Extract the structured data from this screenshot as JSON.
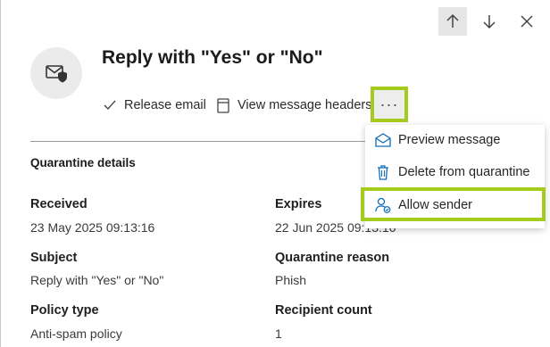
{
  "nav": {
    "up_icon": "arrow-up-icon",
    "down_icon": "arrow-down-icon",
    "close_icon": "close-icon"
  },
  "header": {
    "title": "Reply with \"Yes\" or \"No\"",
    "avatar_icon": "quarantined-email-icon"
  },
  "actions": {
    "release_label": "Release email",
    "view_headers_label": "View message headers",
    "more_label": "···"
  },
  "menu": {
    "items": [
      {
        "label": "Preview message",
        "icon": "envelope-open-icon"
      },
      {
        "label": "Delete from quarantine",
        "icon": "trash-icon"
      },
      {
        "label": "Allow sender",
        "icon": "person-check-icon"
      }
    ]
  },
  "details": {
    "section_title": "Quarantine details",
    "received_label": "Received",
    "received_value": "23 May 2025 09:13:16",
    "expires_label": "Expires",
    "expires_value": "22 Jun 2025 09:13:16",
    "subject_label": "Subject",
    "subject_value": "Reply with \"Yes\" or \"No\"",
    "reason_label": "Quarantine reason",
    "reason_value": "Phish",
    "policy_label": "Policy type",
    "policy_value": "Anti-spam policy",
    "recipients_label": "Recipient count",
    "recipients_value": "1"
  },
  "colors": {
    "highlight": "#a5cc1d",
    "accent": "#0f6cbd"
  }
}
